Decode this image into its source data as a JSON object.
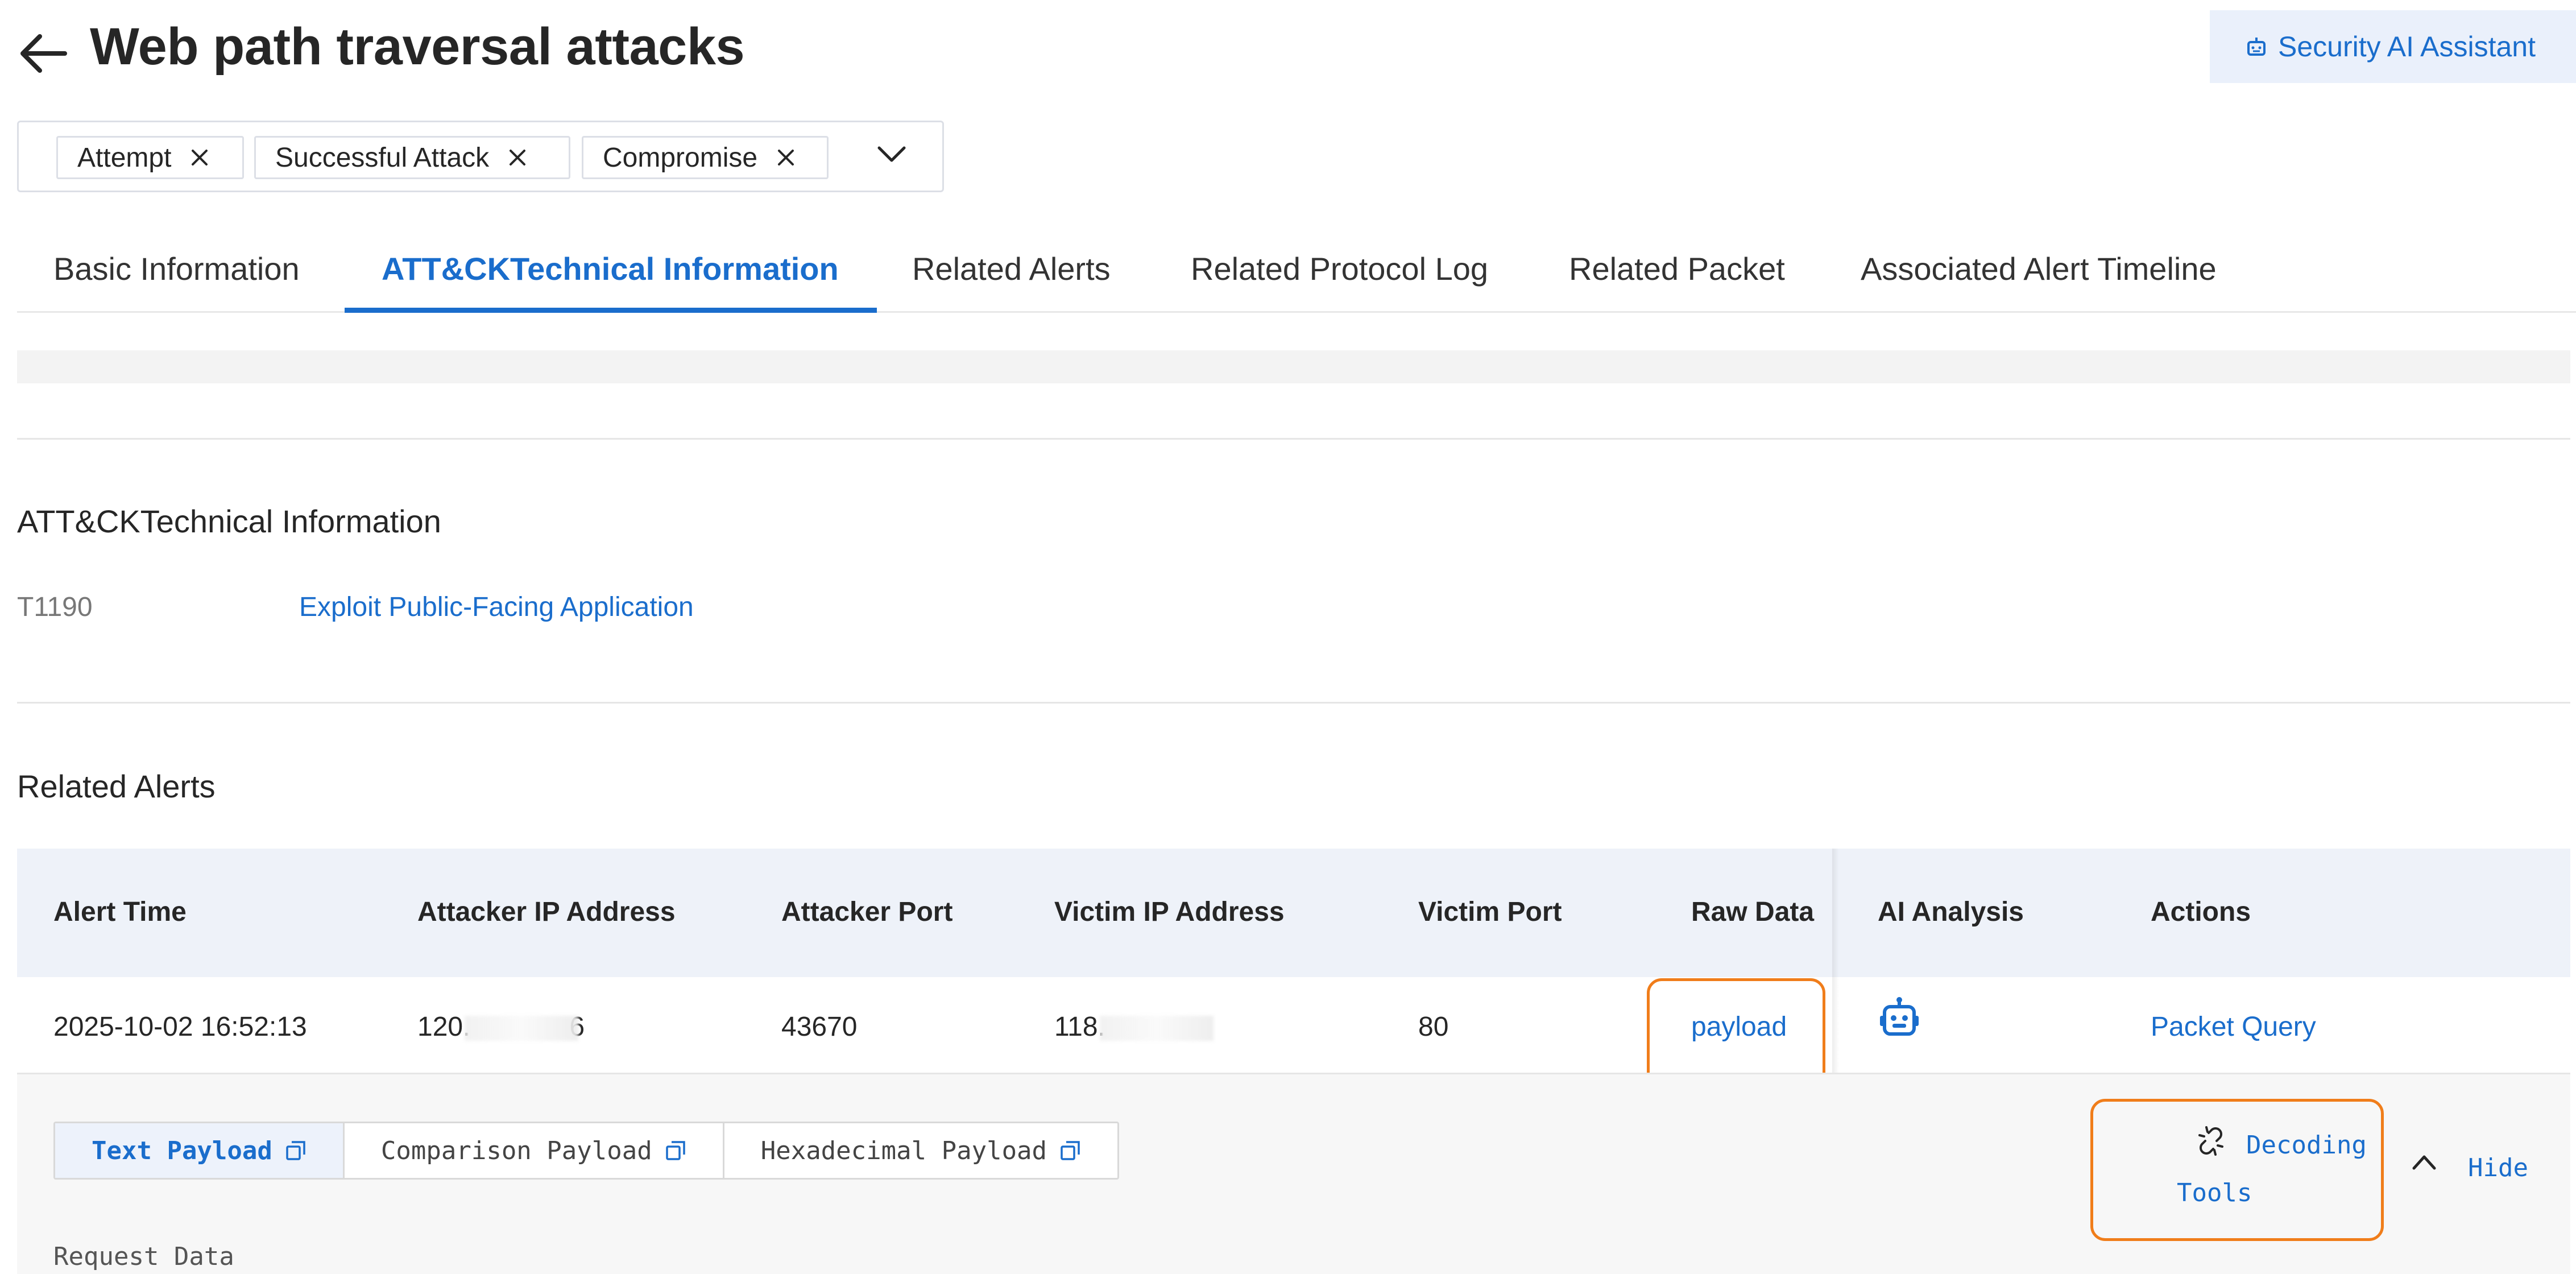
{
  "header": {
    "title": "Web path traversal attacks",
    "ai_assistant_label": "Security AI Assistant"
  },
  "tags": [
    "Attempt",
    "Successful Attack",
    "Compromise"
  ],
  "tabs": [
    {
      "label": "Basic Information",
      "active": false
    },
    {
      "label": "ATT&CKTechnical Information",
      "active": true
    },
    {
      "label": "Related Alerts",
      "active": false
    },
    {
      "label": "Related Protocol Log",
      "active": false
    },
    {
      "label": "Related Packet",
      "active": false
    },
    {
      "label": "Associated Alert Timeline",
      "active": false
    }
  ],
  "attack": {
    "section_title": "ATT&CKTechnical Information",
    "technique_id": "T1190",
    "technique_name": "Exploit Public-Facing Application"
  },
  "related_alerts": {
    "section_title": "Related Alerts",
    "columns": [
      "Alert Time",
      "Attacker IP Address",
      "Attacker Port",
      "Victim IP Address",
      "Victim Port",
      "Raw Data",
      "AI Analysis",
      "Actions"
    ],
    "rows": [
      {
        "alert_time": "2025-10-02 16:52:13",
        "attacker_ip": "120.",
        "attacker_ip_tail": "6",
        "attacker_port": "43670",
        "victim_ip": "118.",
        "victim_port": "80",
        "raw_data": "payload",
        "action": "Packet Query"
      }
    ]
  },
  "payload_panel": {
    "tabs": [
      {
        "label": "Text Payload",
        "active": true
      },
      {
        "label": "Comparison Payload",
        "active": false
      },
      {
        "label": "Hexadecimal Payload",
        "active": false
      }
    ],
    "decoding_tools_line1": "Decoding",
    "decoding_tools_line2": "Tools",
    "hide_label": "Hide",
    "request_data_label": "Request Data"
  },
  "colors": {
    "accent": "#1a6dcc",
    "highlight_box": "#f07d1a",
    "table_header_bg": "#eef2f9"
  },
  "icons": [
    "back-arrow-icon",
    "robot-icon",
    "close-icon",
    "chevron-down-icon",
    "external-copy-icon",
    "unlink-icon",
    "chevron-up-icon",
    "ai-robot-icon"
  ]
}
